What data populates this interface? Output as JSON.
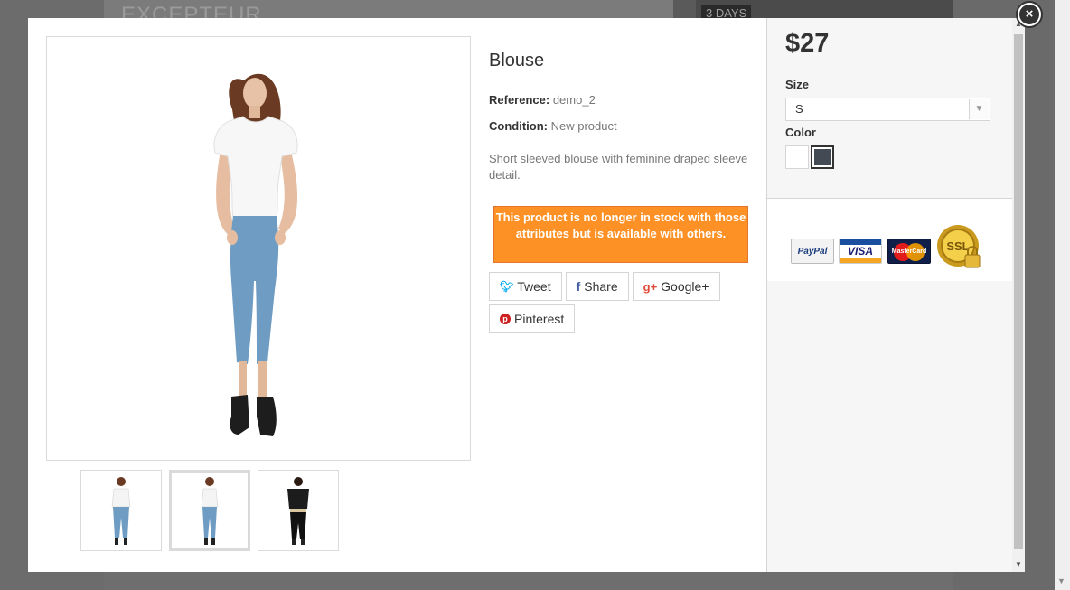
{
  "background": {
    "banner_text": "EXCEPTEUR",
    "badge_text": "3 DAYS"
  },
  "modal": {
    "close_label": "×",
    "product": {
      "name": "Blouse",
      "reference_label": "Reference:",
      "reference_value": "demo_2",
      "condition_label": "Condition:",
      "condition_value": "New product",
      "description": "Short sleeved blouse with feminine draped sleeve detail.",
      "stock_message": "This product is no longer in stock with those attributes but is available with others."
    },
    "thumbnails": [
      {
        "name": "thumbnail-1",
        "shirt_color": "#f4f4f4"
      },
      {
        "name": "thumbnail-2",
        "shirt_color": "#f4f4f4",
        "active": true
      },
      {
        "name": "thumbnail-3",
        "shirt_color": "#1c1c1c"
      }
    ],
    "social": {
      "tweet": "Tweet",
      "share": "Share",
      "googleplus": "Google+",
      "pinterest": "Pinterest"
    },
    "panel": {
      "price": "$27",
      "size_label": "Size",
      "size_value": "S",
      "color_label": "Color",
      "colors": [
        "#ffffff",
        "#434a54"
      ],
      "payments": {
        "paypal": "PayPal",
        "visa": "VISA",
        "mastercard": "MasterCard",
        "ssl": "SSL"
      }
    }
  }
}
